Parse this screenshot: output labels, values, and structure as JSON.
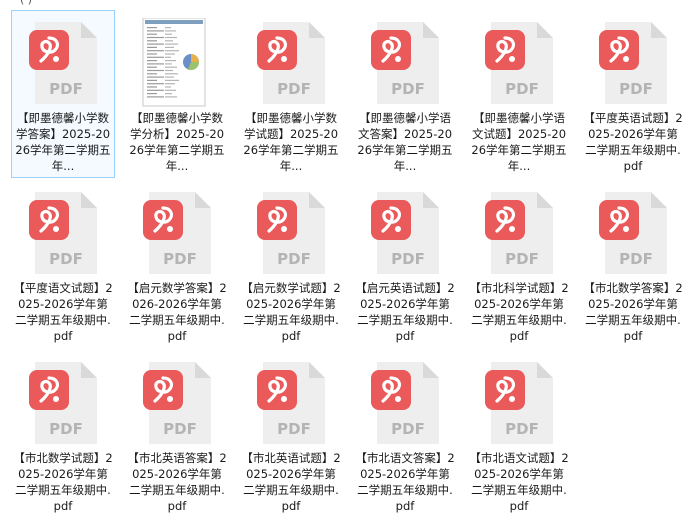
{
  "top_fragment": "(  )",
  "file_type_label": "PDF",
  "files": [
    {
      "name": "【即墨德馨小学数学答案】2025-2026学年第二学期五年...",
      "thumb": "pdf",
      "selected": true
    },
    {
      "name": "【即墨德馨小学数学分析】2025-2026学年第二学期五年...",
      "thumb": "preview"
    },
    {
      "name": "【即墨德馨小学数学试题】2025-2026学年第二学期五年...",
      "thumb": "pdf"
    },
    {
      "name": "【即墨德馨小学语文答案】2025-2026学年第二学期五年...",
      "thumb": "pdf"
    },
    {
      "name": "【即墨德馨小学语文试题】2025-2026学年第二学期五年...",
      "thumb": "pdf"
    },
    {
      "name": "【平度英语试题】2025-2026学年第二学期五年级期中.pdf",
      "thumb": "pdf"
    },
    {
      "name": "【平度语文试题】2025-2026学年第二学期五年级期中.pdf",
      "thumb": "pdf"
    },
    {
      "name": "【启元数学答案】2026-2026学年第二学期五年级期中.pdf",
      "thumb": "pdf"
    },
    {
      "name": "【启元数学试题】2025-2026学年第二学期五年级期中.pdf",
      "thumb": "pdf"
    },
    {
      "name": "【启元英语试题】2025-2026学年第二学期五年级期中.pdf",
      "thumb": "pdf"
    },
    {
      "name": "【市北科学试题】2025-2026学年第二学期五年级期中.pdf",
      "thumb": "pdf"
    },
    {
      "name": "【市北数学答案】2025-2026学年第二学期五年级期中.pdf",
      "thumb": "pdf"
    },
    {
      "name": "【市北数学试题】2025-2026学年第二学期五年级期中.pdf",
      "thumb": "pdf"
    },
    {
      "name": "【市北英语答案】2025-2026学年第二学期五年级期中.pdf",
      "thumb": "pdf"
    },
    {
      "name": "【市北英语试题】2025-2026学年第二学期五年级期中.pdf",
      "thumb": "pdf"
    },
    {
      "name": "【市北语文答案】2025-2026学年第二学期五年级期中.pdf",
      "thumb": "pdf"
    },
    {
      "name": "【市北语文试题】2025-2026学年第二学期五年级期中.pdf",
      "thumb": "pdf"
    }
  ],
  "colors": {
    "pdf_badge": "#ea5a5a",
    "page_body": "#eeeeee",
    "page_fold": "#d9d9d9",
    "pdf_text": "#b4b4b4",
    "selection_border": "#99d1ff",
    "text": "#1a1a1a"
  },
  "icons": {
    "pdf": "pdf-file-icon",
    "preview": "document-preview-thumbnail"
  }
}
